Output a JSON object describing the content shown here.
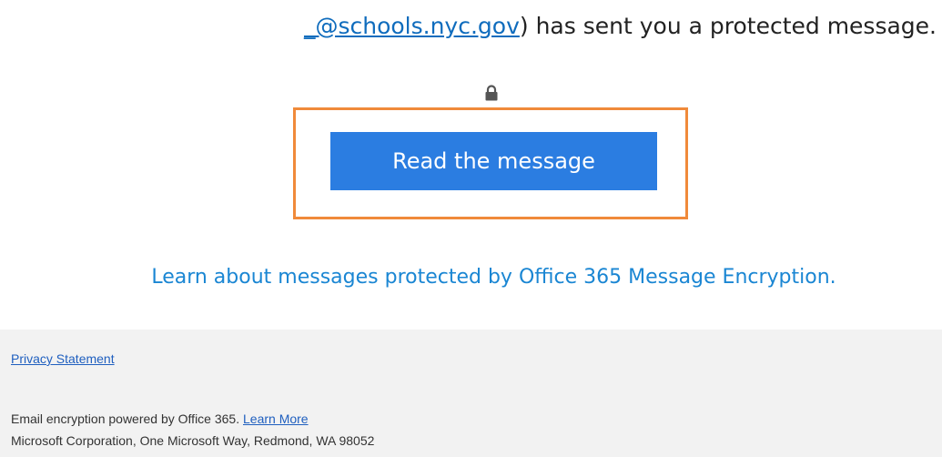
{
  "header": {
    "sender_link": "_@schools.nyc.gov",
    "sender_suffix": ") has sent you a protected message."
  },
  "lock": {
    "icon": "lock-icon"
  },
  "main": {
    "read_button_label": "Read the message",
    "learn_link": "Learn about messages protected by Office 365 Message Encryption."
  },
  "footer": {
    "privacy_link": "Privacy Statement",
    "powered_text": "Email encryption powered by Office 365. ",
    "learn_more": "Learn More",
    "address": "Microsoft Corporation, One Microsoft Way, Redmond, WA 98052"
  },
  "colors": {
    "button_bg": "#2b7de1",
    "highlight_border": "#f08a3a",
    "link": "#1a86d3",
    "footer_bg": "#f2f2f2"
  }
}
